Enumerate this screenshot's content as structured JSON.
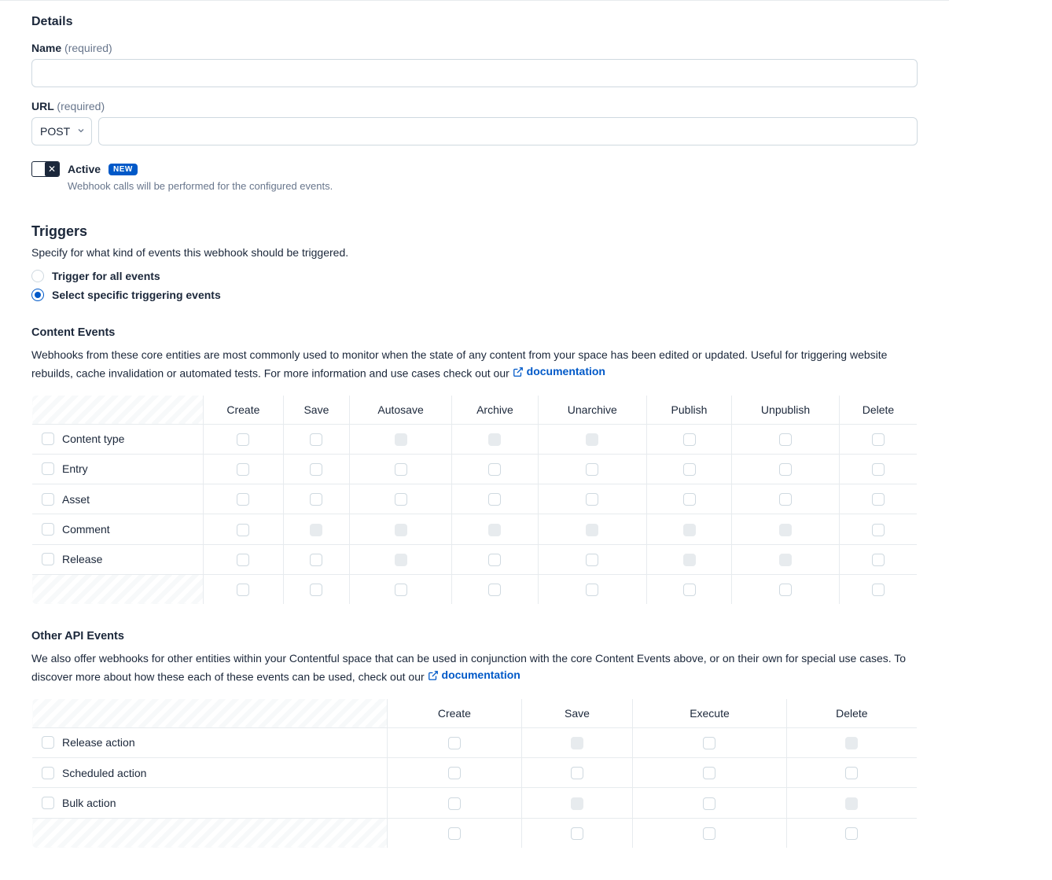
{
  "details": {
    "heading": "Details",
    "name_label": "Name",
    "name_req": "(required)",
    "name_value": "",
    "url_label": "URL",
    "url_req": "(required)",
    "method": "POST",
    "url_value": "",
    "active_label": "Active",
    "new_badge": "NEW",
    "active_help": "Webhook calls will be performed for the configured events."
  },
  "triggers": {
    "heading": "Triggers",
    "desc": "Specify for what kind of events this webhook should be triggered.",
    "radio_all": "Trigger for all events",
    "radio_specific": "Select specific triggering events"
  },
  "content_events": {
    "title": "Content Events",
    "desc_a": "Webhooks from these core entities are most commonly used to monitor when the state of any content from your space has been edited or updated. Useful for triggering website rebuilds, cache invalidation or automated tests. For more information and use cases check out our ",
    "doc_link": "documentation",
    "columns": [
      "Create",
      "Save",
      "Autosave",
      "Archive",
      "Unarchive",
      "Publish",
      "Unpublish",
      "Delete"
    ],
    "rows": [
      {
        "label": "Content type",
        "disabled": [
          2,
          3,
          4
        ]
      },
      {
        "label": "Entry",
        "disabled": []
      },
      {
        "label": "Asset",
        "disabled": []
      },
      {
        "label": "Comment",
        "disabled": [
          1,
          2,
          3,
          4,
          5,
          6
        ]
      },
      {
        "label": "Release",
        "disabled": [
          2,
          5,
          6
        ]
      }
    ]
  },
  "other_events": {
    "title": "Other API Events",
    "desc_a": "We also offer webhooks for other entities within your Contentful space that can be used in conjunction with the core Content Events above, or on their own for special use cases. To discover more about how these each of these events can be used, check out our ",
    "doc_link": "documentation",
    "columns": [
      "Create",
      "Save",
      "Execute",
      "Delete"
    ],
    "rows": [
      {
        "label": "Release action",
        "disabled": [
          1,
          3
        ]
      },
      {
        "label": "Scheduled action",
        "disabled": []
      },
      {
        "label": "Bulk action",
        "disabled": [
          1,
          3
        ]
      }
    ]
  }
}
